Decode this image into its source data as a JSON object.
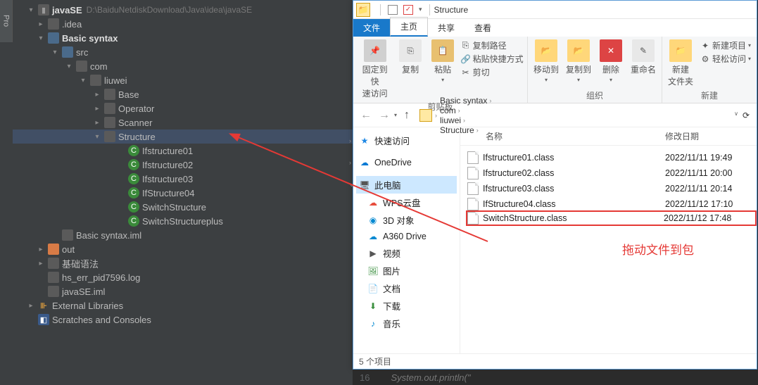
{
  "ide": {
    "left_tab": "Pro",
    "root": {
      "label": "javaSE",
      "path": "D:\\BaiduNetdiskDownload\\Java\\idea\\javaSE"
    },
    "tree": [
      {
        "indent": 34,
        "arrow": "right",
        "icon": "folder-g",
        "label": ".idea"
      },
      {
        "indent": 34,
        "arrow": "down",
        "icon": "folder-b",
        "label": "Basic syntax",
        "bold": true
      },
      {
        "indent": 54,
        "arrow": "down",
        "icon": "folder-b",
        "label": "src"
      },
      {
        "indent": 74,
        "arrow": "down",
        "icon": "folder-g",
        "label": "com"
      },
      {
        "indent": 94,
        "arrow": "down",
        "icon": "folder-g",
        "label": "liuwei"
      },
      {
        "indent": 114,
        "arrow": "right",
        "icon": "folder-g",
        "label": "Base"
      },
      {
        "indent": 114,
        "arrow": "right",
        "icon": "folder-g",
        "label": "Operator"
      },
      {
        "indent": 114,
        "arrow": "right",
        "icon": "folder-g",
        "label": "Scanner"
      },
      {
        "indent": 114,
        "arrow": "down",
        "icon": "folder-g",
        "label": "Structure",
        "selected": true
      },
      {
        "indent": 148,
        "arrow": "none",
        "icon": "class",
        "label": "Ifstructure01"
      },
      {
        "indent": 148,
        "arrow": "none",
        "icon": "class",
        "label": "Ifstructure02"
      },
      {
        "indent": 148,
        "arrow": "none",
        "icon": "class",
        "label": "Ifstructure03"
      },
      {
        "indent": 148,
        "arrow": "none",
        "icon": "class",
        "label": "IfStructure04"
      },
      {
        "indent": 148,
        "arrow": "none",
        "icon": "class",
        "label": "SwitchStructure"
      },
      {
        "indent": 148,
        "arrow": "none",
        "icon": "class",
        "label": "SwitchStructureplus"
      },
      {
        "indent": 54,
        "arrow": "none",
        "icon": "file",
        "label": "Basic syntax.iml"
      },
      {
        "indent": 34,
        "arrow": "right",
        "icon": "folder-o",
        "label": "out"
      },
      {
        "indent": 34,
        "arrow": "right",
        "icon": "folder-g",
        "label": "基础语法"
      },
      {
        "indent": 34,
        "arrow": "none",
        "icon": "file",
        "label": "hs_err_pid7596.log"
      },
      {
        "indent": 34,
        "arrow": "none",
        "icon": "file",
        "label": "javaSE.iml"
      },
      {
        "indent": 20,
        "arrow": "right",
        "icon": "lib",
        "label": "External Libraries"
      },
      {
        "indent": 20,
        "arrow": "none",
        "icon": "scr",
        "label": "Scratches and Consoles"
      }
    ]
  },
  "explorer": {
    "title": "Structure",
    "tabs": {
      "file": "文件",
      "home": "主页",
      "share": "共享",
      "view": "查看"
    },
    "ribbon": {
      "pin": "固定到快\n速访问",
      "copy": "复制",
      "paste": "粘贴",
      "paste_sub": {
        "copypath": "复制路径",
        "paste_shortcut": "粘贴快捷方式",
        "cut": "剪切"
      },
      "clipboard": "剪贴板",
      "moveto": "移动到",
      "copyto": "复制到",
      "delete": "删除",
      "rename": "重命名",
      "organize": "组织",
      "newfolder": "新建\n文件夹",
      "newitem": "新建项目",
      "easyaccess": "轻松访问",
      "new": "新建"
    },
    "breadcrumb": [
      "Basic syntax",
      "com",
      "liuwei",
      "Structure"
    ],
    "nav": [
      {
        "icon": "star",
        "label": "快速访问",
        "head": true,
        "arrow": ">"
      },
      {
        "icon": "onedrive",
        "label": "OneDrive",
        "head": true,
        "arrow": ">"
      },
      {
        "icon": "pc",
        "label": "此电脑",
        "head": true,
        "arrow": "v",
        "sel": true
      },
      {
        "icon": "wps",
        "label": "WPS云盘"
      },
      {
        "icon": "threed",
        "label": "3D 对象"
      },
      {
        "icon": "a360",
        "label": "A360 Drive"
      },
      {
        "icon": "video",
        "label": "视频"
      },
      {
        "icon": "pic",
        "label": "图片"
      },
      {
        "icon": "doc",
        "label": "文档"
      },
      {
        "icon": "dl",
        "label": "下载"
      },
      {
        "icon": "music",
        "label": "音乐"
      }
    ],
    "headers": {
      "name": "名称",
      "date": "修改日期"
    },
    "files": [
      {
        "name": "Ifstructure01.class",
        "date": "2022/11/11 19:49"
      },
      {
        "name": "Ifstructure02.class",
        "date": "2022/11/11 20:00"
      },
      {
        "name": "Ifstructure03.class",
        "date": "2022/11/11 20:14"
      },
      {
        "name": "IfStructure04.class",
        "date": "2022/11/12 17:10"
      },
      {
        "name": "SwitchStructure.class",
        "date": "2022/11/12 17:48",
        "highlighted": true
      }
    ],
    "red_annotation": "拖动文件到包",
    "status": "5 个项目"
  },
  "code": {
    "line": "16",
    "text": "System.out.println(\""
  }
}
